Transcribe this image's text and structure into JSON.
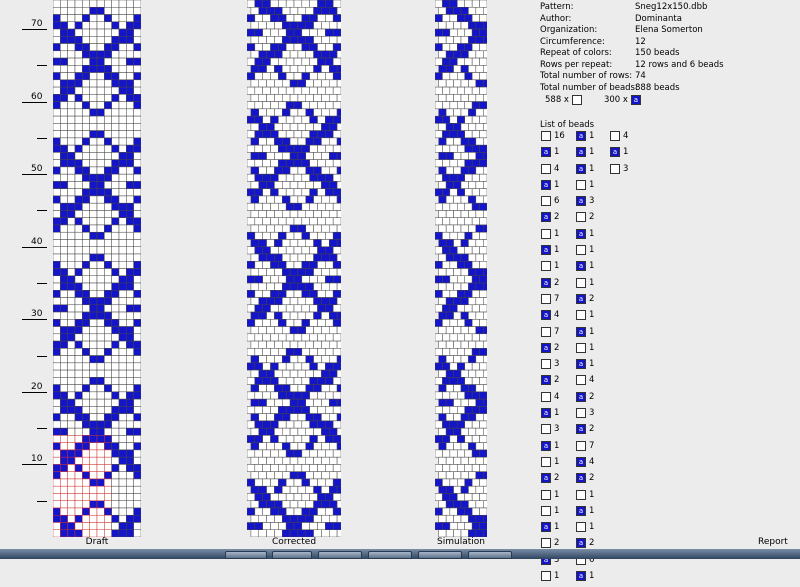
{
  "ruler": {
    "labels": [
      "70",
      "60",
      "50",
      "40",
      "30",
      "20",
      "10"
    ]
  },
  "panels": {
    "draft": "Draft",
    "corrected": "Corrected",
    "simulation": "Simulation",
    "report": "Report"
  },
  "info": [
    {
      "label": "Pattern:",
      "value": "Sneg12x150.dbb"
    },
    {
      "label": "Author:",
      "value": "Dominanta"
    },
    {
      "label": "Organization:",
      "value": "Elena Somerton"
    },
    {
      "label": "Circumference:",
      "value": "12"
    },
    {
      "label": "Repeat of colors:",
      "value": "150 beads"
    },
    {
      "label": "Rows per repeat:",
      "value": "12 rows and 6 beads"
    },
    {
      "label": "Total number of rows:",
      "value": "74"
    },
    {
      "label": "Total number of beads:",
      "value": "888 beads"
    }
  ],
  "counts": {
    "white": "588 x",
    "blue": "300 x"
  },
  "bead_glyph": "a",
  "bead_list_title": "List of beads",
  "colors": {
    "blue": "#1414c8",
    "white": "#ffffff",
    "grid": "#444444",
    "draft_accent": "#cc3333"
  },
  "bead_list": {
    "col1": [
      {
        "c": "w",
        "n": "16"
      },
      {
        "c": "b",
        "n": "1"
      },
      {
        "c": "w",
        "n": "4"
      },
      {
        "c": "b",
        "n": "1"
      },
      {
        "c": "w",
        "n": "6"
      },
      {
        "c": "b",
        "n": "2"
      },
      {
        "c": "w",
        "n": "1"
      },
      {
        "c": "b",
        "n": "1"
      },
      {
        "c": "w",
        "n": "1"
      },
      {
        "c": "b",
        "n": "2"
      },
      {
        "c": "w",
        "n": "7"
      },
      {
        "c": "b",
        "n": "4"
      },
      {
        "c": "w",
        "n": "7"
      },
      {
        "c": "b",
        "n": "2"
      },
      {
        "c": "w",
        "n": "3"
      },
      {
        "c": "b",
        "n": "2"
      },
      {
        "c": "w",
        "n": "4"
      },
      {
        "c": "b",
        "n": "1"
      },
      {
        "c": "w",
        "n": "3"
      },
      {
        "c": "b",
        "n": "1"
      },
      {
        "c": "w",
        "n": "1"
      },
      {
        "c": "b",
        "n": "2"
      },
      {
        "c": "w",
        "n": "1"
      },
      {
        "c": "w",
        "n": "1"
      },
      {
        "c": "b",
        "n": "1"
      },
      {
        "c": "w",
        "n": "2"
      },
      {
        "c": "b",
        "n": "3"
      },
      {
        "c": "w",
        "n": "1"
      }
    ],
    "col2": [
      {
        "c": "b",
        "n": "1"
      },
      {
        "c": "b",
        "n": "1"
      },
      {
        "c": "b",
        "n": "1"
      },
      {
        "c": "w",
        "n": "1"
      },
      {
        "c": "b",
        "n": "3"
      },
      {
        "c": "w",
        "n": "2"
      },
      {
        "c": "b",
        "n": "1"
      },
      {
        "c": "w",
        "n": "1"
      },
      {
        "c": "b",
        "n": "1"
      },
      {
        "c": "w",
        "n": "1"
      },
      {
        "c": "b",
        "n": "2"
      },
      {
        "c": "w",
        "n": "1"
      },
      {
        "c": "b",
        "n": "1"
      },
      {
        "c": "w",
        "n": "1"
      },
      {
        "c": "b",
        "n": "1"
      },
      {
        "c": "w",
        "n": "4"
      },
      {
        "c": "b",
        "n": "2"
      },
      {
        "c": "w",
        "n": "3"
      },
      {
        "c": "b",
        "n": "2"
      },
      {
        "c": "w",
        "n": "7"
      },
      {
        "c": "b",
        "n": "4"
      },
      {
        "c": "b",
        "n": "2"
      },
      {
        "c": "w",
        "n": "1"
      },
      {
        "c": "b",
        "n": "1"
      },
      {
        "c": "w",
        "n": "1"
      },
      {
        "c": "b",
        "n": "2"
      },
      {
        "c": "w",
        "n": "6"
      },
      {
        "c": "b",
        "n": "1"
      }
    ],
    "col3": [
      {
        "c": "w",
        "n": "4"
      },
      {
        "c": "b",
        "n": "1"
      },
      {
        "c": "w",
        "n": "3"
      }
    ]
  }
}
